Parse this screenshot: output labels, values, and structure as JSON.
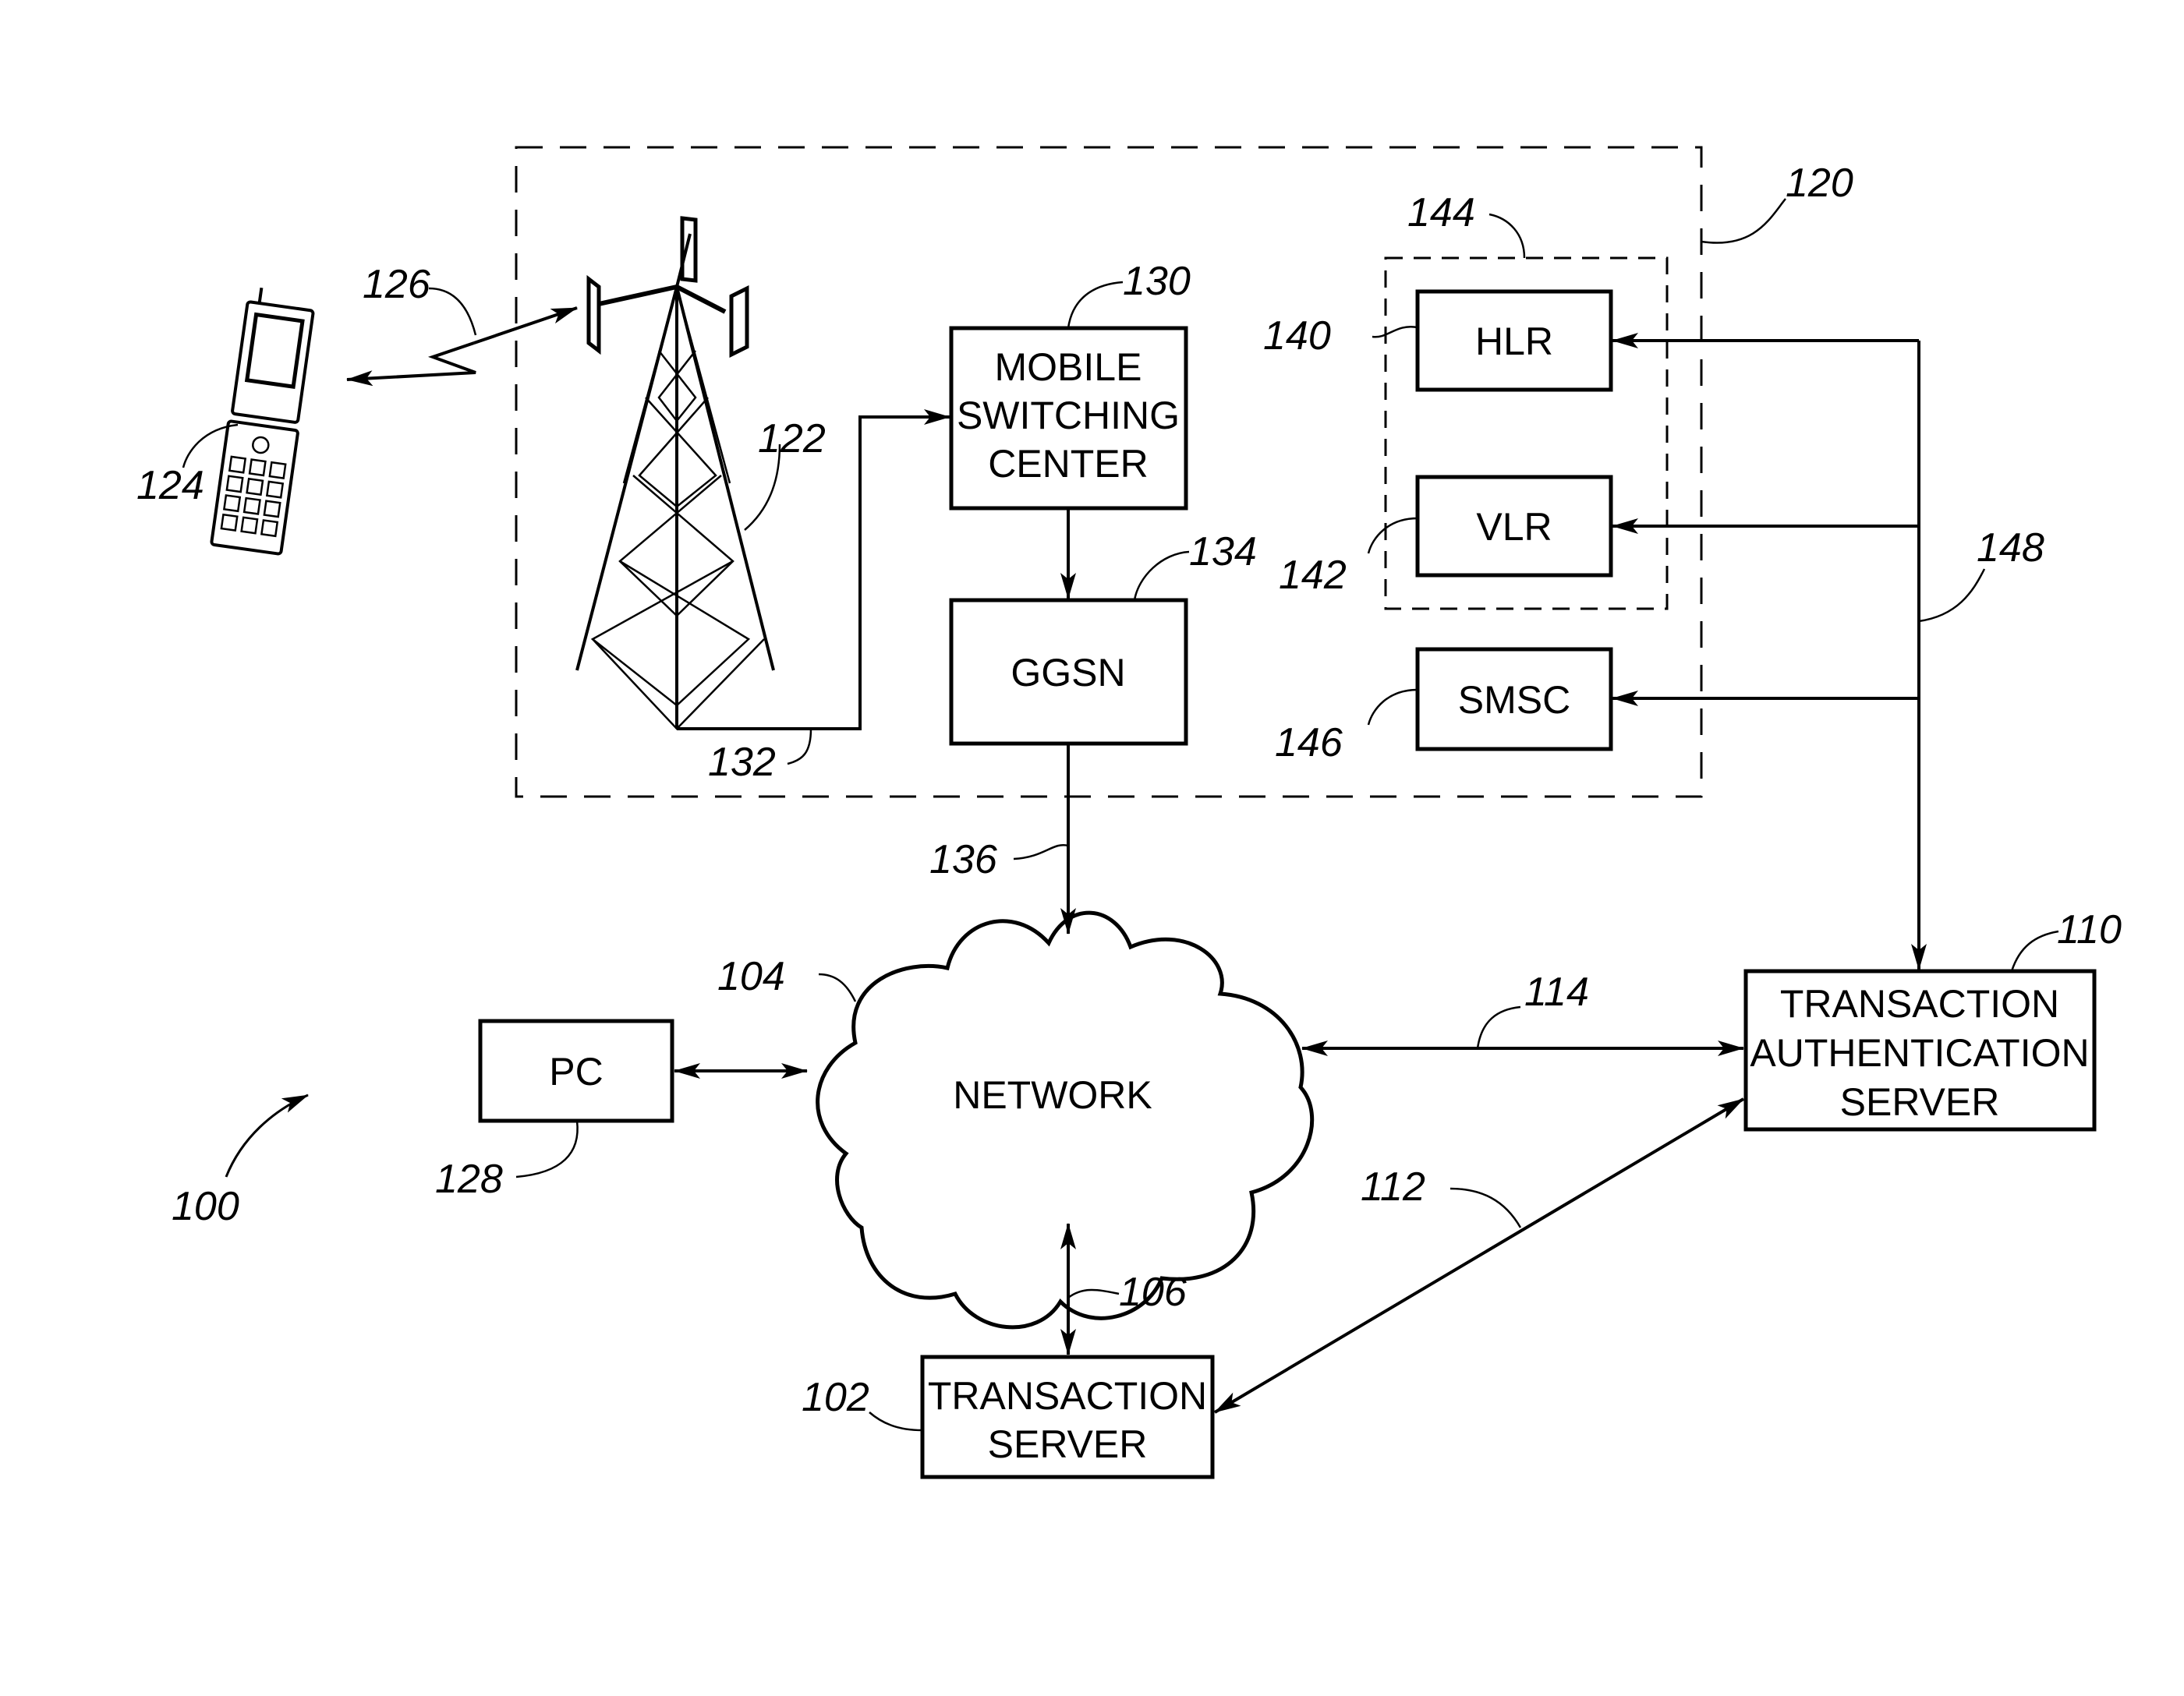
{
  "figure": {
    "reference": "100",
    "components": {
      "mobile_network": {
        "ref": "120"
      },
      "tower": {
        "ref": "122"
      },
      "mobile_device": {
        "ref": "124"
      },
      "wireless_link": {
        "ref": "126"
      },
      "tower_link": {
        "ref": "132"
      },
      "msc": {
        "ref": "130",
        "lines": [
          "MOBILE",
          "SWITCHING",
          "CENTER"
        ]
      },
      "ggsn": {
        "ref": "134",
        "lines": [
          "GGSN"
        ]
      },
      "ggsn_link": {
        "ref": "136"
      },
      "hlr_vlr_group": {
        "ref": "144"
      },
      "hlr": {
        "ref": "140",
        "lines": [
          "HLR"
        ]
      },
      "vlr": {
        "ref": "142",
        "lines": [
          "VLR"
        ]
      },
      "smsc": {
        "ref": "146",
        "lines": [
          "SMSC"
        ]
      },
      "bus": {
        "ref": "148"
      },
      "network": {
        "ref": "104",
        "lines": [
          "NETWORK"
        ]
      },
      "pc": {
        "ref": "128",
        "lines": [
          "PC"
        ]
      },
      "transaction_server": {
        "ref": "102",
        "lines": [
          "TRANSACTION",
          "SERVER"
        ]
      },
      "server_link": {
        "ref": "106"
      },
      "auth_server": {
        "ref": "110",
        "lines": [
          "TRANSACTION",
          "AUTHENTICATION",
          "SERVER"
        ]
      },
      "network_auth_link": {
        "ref": "114"
      },
      "server_auth_link": {
        "ref": "112"
      }
    }
  }
}
